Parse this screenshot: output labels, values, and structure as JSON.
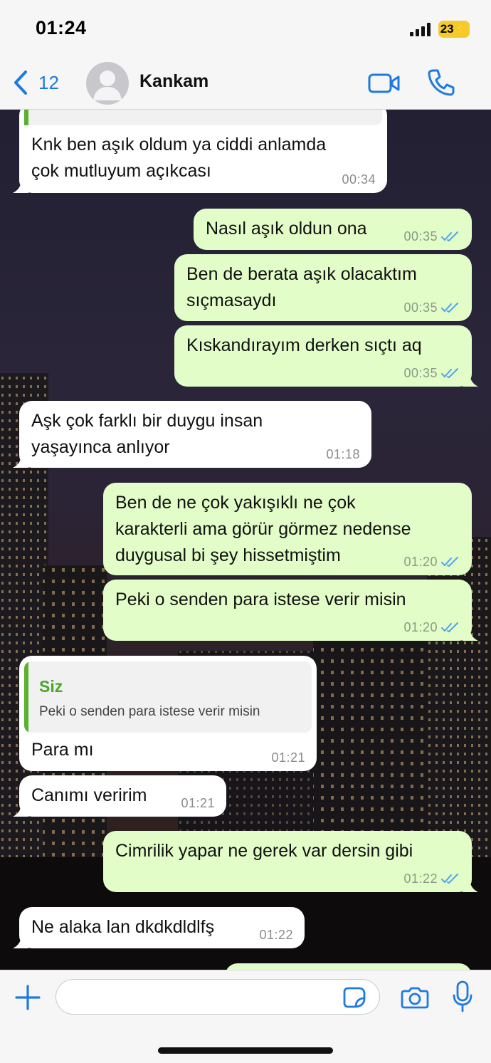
{
  "status_bar": {
    "time": "01:24",
    "battery": "23",
    "icons": [
      "signal-icon",
      "battery-charging-icon"
    ]
  },
  "header": {
    "back_count": "12",
    "contact_name": "Kankam",
    "icons": [
      "chevron-left-icon",
      "avatar-icon",
      "video-call-icon",
      "phone-icon"
    ]
  },
  "colors": {
    "accent": "#1f7ae0",
    "incoming_bubble": "#ffffff",
    "outgoing_bubble": "#e2fdc8",
    "read_ticks": "#4ea3f0",
    "reply_name": "#4aa52a"
  },
  "messages": [
    {
      "direction": "in",
      "text": "Knk ben aşık oldum ya ciddi anlamda\nçok mutluyum açıkcası",
      "time": "00:34"
    },
    {
      "direction": "out",
      "text": "Nasıl aşık oldun ona",
      "time": "00:35",
      "status": "read"
    },
    {
      "direction": "out",
      "text": "Ben de berata aşık olacaktım\nsıçmasaydı",
      "time": "00:35",
      "status": "read"
    },
    {
      "direction": "out",
      "text": "Kıskandırayım derken sıçtı aq",
      "time": "00:35",
      "status": "read"
    },
    {
      "direction": "in",
      "text": "Aşk çok farklı bir duygu insan\nyaşayınca anlıyor",
      "time": "01:18"
    },
    {
      "direction": "out",
      "text": "Ben de ne çok yakışıklı ne çok\nkarakterli ama görür görmez nedense\nduygusal bi şey hissetmiştim",
      "time": "01:20",
      "status": "read"
    },
    {
      "direction": "out",
      "text": "Peki o senden para istese verir misin",
      "time": "01:20",
      "status": "read"
    },
    {
      "direction": "in",
      "text": "Para mı",
      "time": "01:21",
      "reply": {
        "sender": "Siz",
        "text": "Peki o senden para istese verir misin"
      }
    },
    {
      "direction": "in",
      "text": "Canımı veririm",
      "time": "01:21"
    },
    {
      "direction": "out",
      "text": "Cimrilik yapar ne gerek var dersin gibi",
      "time": "01:22",
      "status": "read"
    },
    {
      "direction": "in",
      "text": "Ne alaka lan dkdkdldlfş",
      "time": "01:22"
    }
  ],
  "input_bar": {
    "placeholder": "",
    "value": "",
    "icons": [
      "plus-icon",
      "sticker-icon",
      "camera-icon",
      "microphone-icon"
    ]
  }
}
